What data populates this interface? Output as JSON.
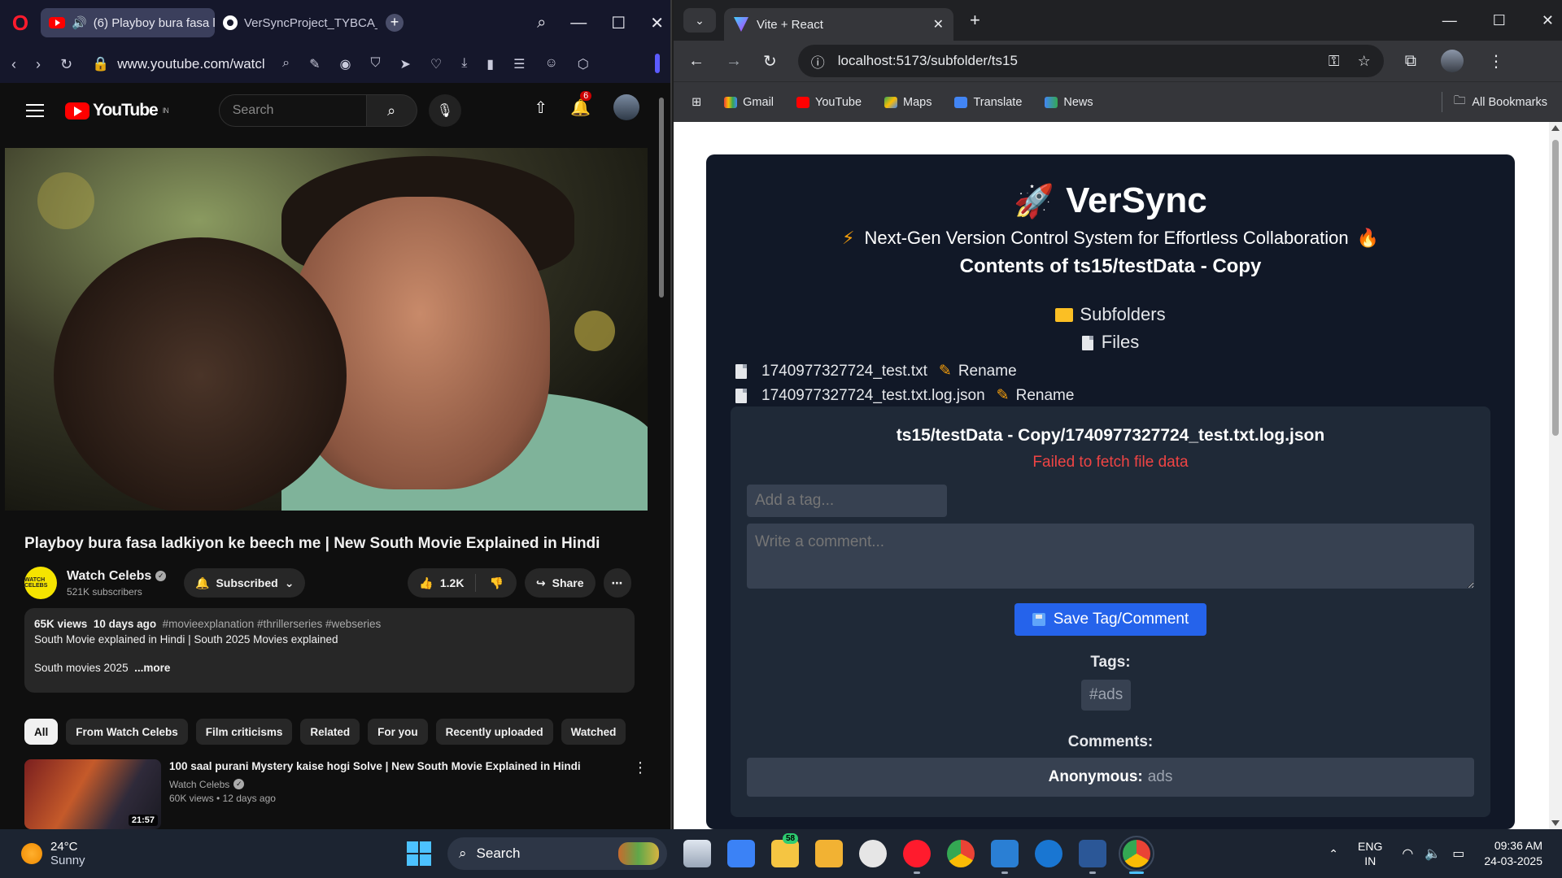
{
  "left_browser": {
    "tabs": [
      {
        "label": "(6) Playboy bura fasa l",
        "active": true
      },
      {
        "label": "VerSyncProject_TYBCA_SE",
        "active": false
      }
    ],
    "url": "www.youtube.com/watcl"
  },
  "youtube": {
    "logo_text": "YouTube",
    "region": "IN",
    "search_placeholder": "Search",
    "notification_count": "6",
    "video_title": "Playboy bura fasa ladkiyon ke beech me | New South Movie Explained in Hindi",
    "channel_name": "Watch Celebs",
    "channel_logo_text": "WATCH CELEBS",
    "subscribers": "521K subscribers",
    "subscribed_label": "Subscribed",
    "likes": "1.2K",
    "share_label": "Share",
    "views": "65K views",
    "age": "10 days ago",
    "hashtags": "#movieexplanation #thrillerseries #webseries",
    "desc_line1": "South Movie explained in Hindi | South 2025 Movies explained",
    "desc_line2": "South movies 2025",
    "more_label": "...more",
    "chips": [
      "All",
      "From Watch Celebs",
      "Film criticisms",
      "Related",
      "For you",
      "Recently uploaded",
      "Watched"
    ],
    "recommended": {
      "title": "100 saal purani Mystery kaise hogi Solve | New South Movie Explained in Hindi",
      "channel": "Watch Celebs",
      "meta": "60K views • 12 days ago",
      "duration": "21:57"
    }
  },
  "right_browser": {
    "tab_title": "Vite + React",
    "url": "localhost:5173/subfolder/ts15",
    "bookmarks": [
      "Gmail",
      "YouTube",
      "Maps",
      "Translate",
      "News"
    ],
    "all_bookmarks": "All Bookmarks"
  },
  "app": {
    "brand": "VerSync",
    "tagline": "Next-Gen Version Control System for Effortless Collaboration",
    "contents_title": "Contents of ts15/testData - Copy",
    "subfolders_label": "Subfolders",
    "files_label": "Files",
    "rename_label": "Rename",
    "files": [
      "1740977327724_test.txt",
      "1740977327724_test.txt.log.json"
    ],
    "viewer_path": "ts15/testData - Copy/1740977327724_test.txt.log.json",
    "error": "Failed to fetch file data",
    "tag_placeholder": "Add a tag...",
    "comment_placeholder": "Write a comment...",
    "save_label": "Save Tag/Comment",
    "tags_heading": "Tags:",
    "tags": [
      "#ads"
    ],
    "comments_heading": "Comments:",
    "comments": [
      {
        "author": "Anonymous:",
        "text": "ads"
      }
    ]
  },
  "taskbar": {
    "temperature": "24°C",
    "weather": "Sunny",
    "search_label": "Search",
    "badge": "58",
    "lang": "ENG",
    "region": "IN",
    "time": "09:36 AM",
    "date": "24-03-2025"
  },
  "colors": {
    "accent_blue": "#2563eb",
    "error_red": "#ef4444",
    "yt_red": "#ff0000"
  }
}
